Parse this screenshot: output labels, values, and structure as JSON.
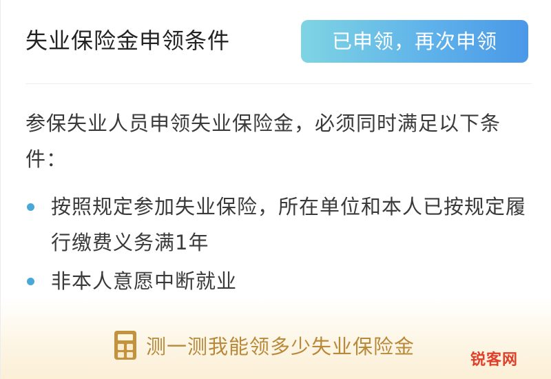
{
  "header": {
    "title": "失业保险金申领条件",
    "reapply_button_label": "已申领，再次申领"
  },
  "intro": "参保失业人员申领失业保险金，必须同时满足以下条件：",
  "conditions": [
    {
      "text": "按照规定参加失业保险，所在单位和本人已按规定履行缴费义务满1年"
    },
    {
      "text": "非本人意愿中断就业"
    }
  ],
  "footer": {
    "link_label": "测一测我能领多少失业保险金",
    "icon": "calculator-icon"
  },
  "watermark": "锐客网",
  "colors": {
    "button_gradient_start": "#7fd4e3",
    "button_gradient_end": "#4a98e8",
    "bullet": "#4aa7d9",
    "link_gold": "#b9893a",
    "footer_tint": "#fbefd6",
    "watermark": "#e0402a"
  }
}
